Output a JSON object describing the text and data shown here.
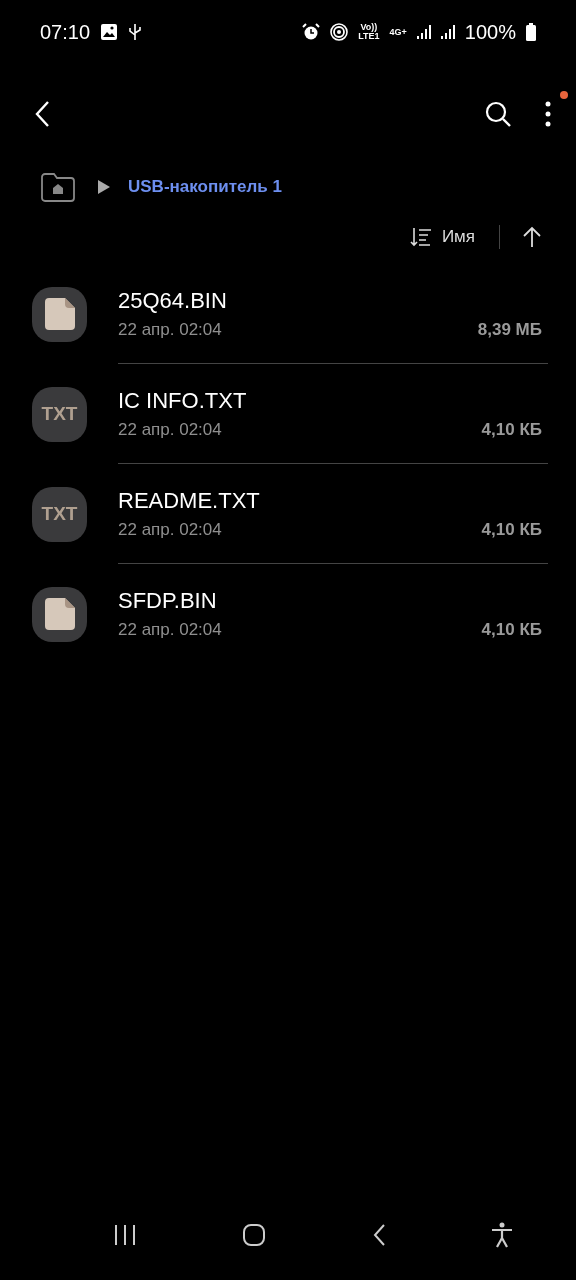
{
  "status_bar": {
    "time": "07:10",
    "volte": "Vo))",
    "lte": "LTE1",
    "network": "4G+",
    "battery": "100%"
  },
  "toolbar": {
    "menu_badge": true
  },
  "breadcrumb": {
    "path": "USB-накопитель 1"
  },
  "sort": {
    "label": "Имя"
  },
  "files": [
    {
      "kind": "bin",
      "name": "25Q64.BIN",
      "date": "22 апр. 02:04",
      "size": "8,39 МБ"
    },
    {
      "kind": "txt",
      "icon_label": "TXT",
      "name": "IC INFO.TXT",
      "date": "22 апр. 02:04",
      "size": "4,10 КБ"
    },
    {
      "kind": "txt",
      "icon_label": "TXT",
      "name": "README.TXT",
      "date": "22 апр. 02:04",
      "size": "4,10 КБ"
    },
    {
      "kind": "bin",
      "name": "SFDP.BIN",
      "date": "22 апр. 02:04",
      "size": "4,10 КБ"
    }
  ]
}
